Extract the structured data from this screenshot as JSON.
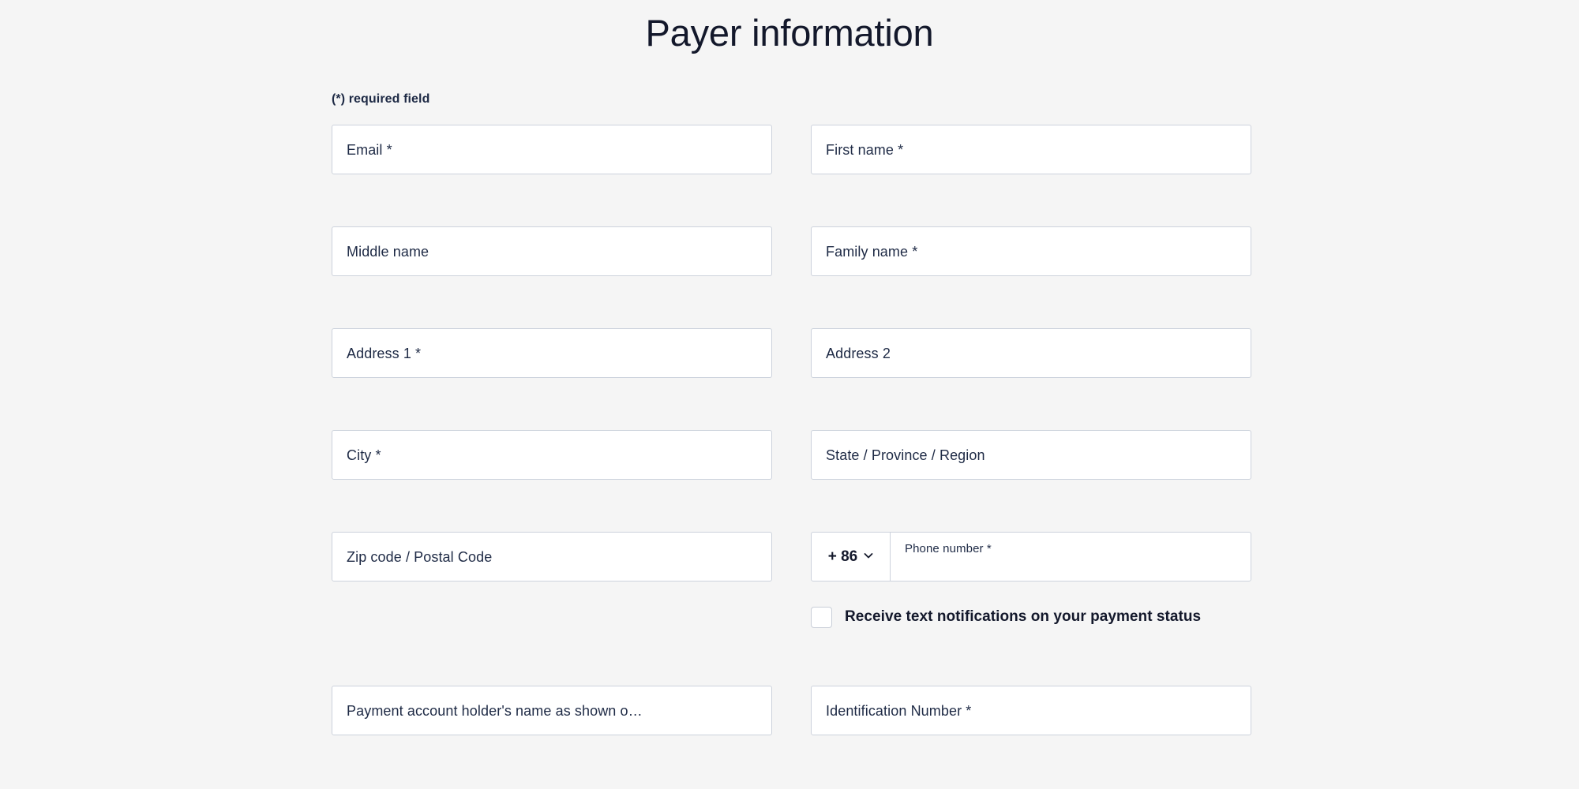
{
  "page": {
    "title": "Payer information",
    "required_note": "(*) required field",
    "background_color": "#f5f5f5",
    "text_color": "#1e2a45",
    "field_border_color": "#ccd2dc"
  },
  "fields": {
    "email": {
      "label": "Email *",
      "value": "",
      "required": true
    },
    "first_name": {
      "label": "First name *",
      "value": "",
      "required": true
    },
    "middle_name": {
      "label": "Middle name",
      "value": "",
      "required": false
    },
    "family_name": {
      "label": "Family name *",
      "value": "",
      "required": true
    },
    "address1": {
      "label": "Address 1 *",
      "value": "",
      "required": true
    },
    "address2": {
      "label": "Address 2",
      "value": "",
      "required": false
    },
    "city": {
      "label": "City *",
      "value": "",
      "required": true
    },
    "state": {
      "label": "State / Province / Region",
      "value": "",
      "required": false
    },
    "zip": {
      "label": "Zip code / Postal Code",
      "value": "",
      "required": false
    },
    "phone": {
      "country_code": "+ 86",
      "dropdown_icon": "chevron-down-icon",
      "label": "Phone number *",
      "value": "",
      "required": true
    },
    "account_holder": {
      "label": "Payment account holder's name as shown o…",
      "value": "",
      "required": false
    },
    "identification_number": {
      "label": "Identification Number *",
      "value": "",
      "required": true
    }
  },
  "checkbox": {
    "label": "Receive text notifications on your payment status",
    "checked": false
  }
}
